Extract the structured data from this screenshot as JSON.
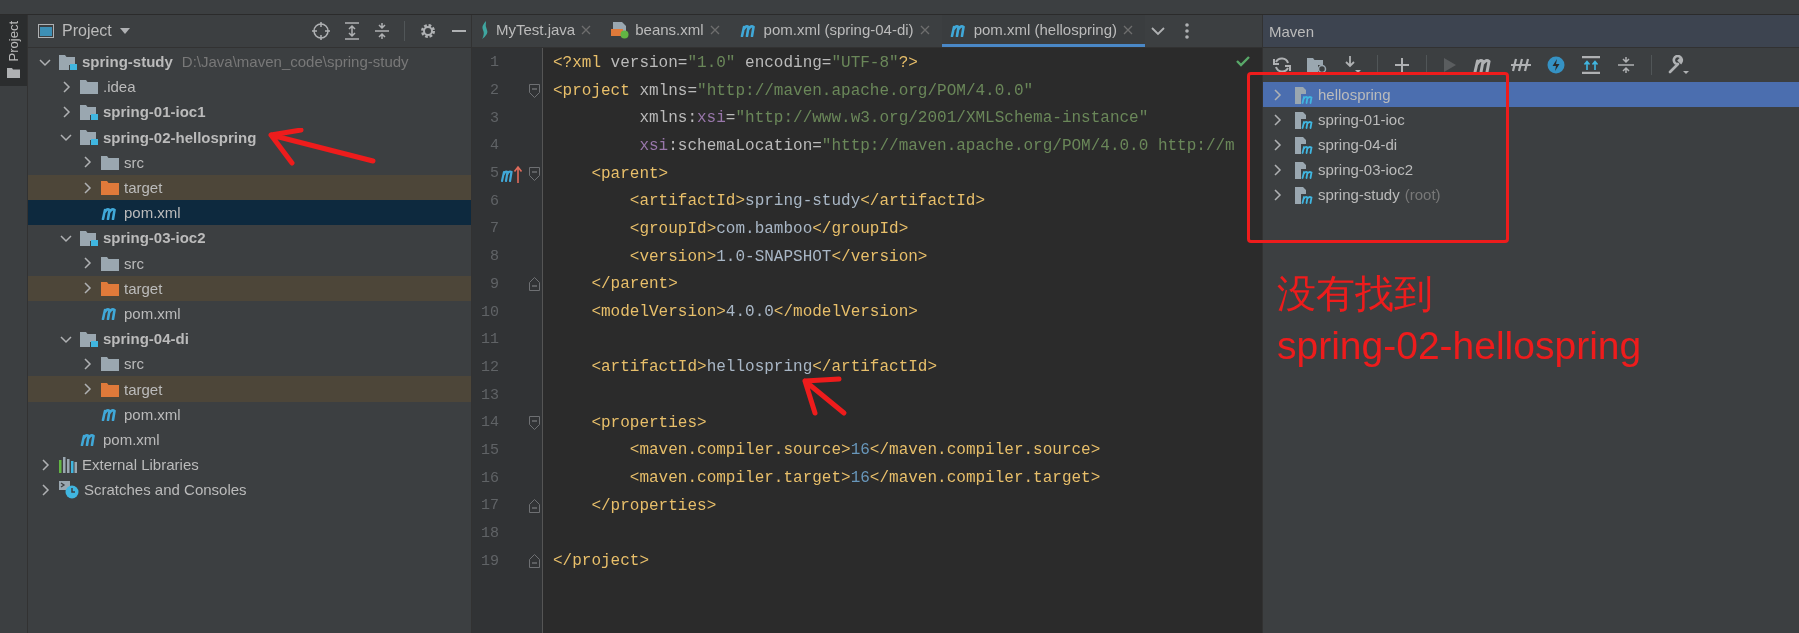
{
  "side_stripe": {
    "label": "Project"
  },
  "project": {
    "title": "Project",
    "tree": [
      {
        "name": "spring-study",
        "path": "D:\\Java\\maven_code\\spring-study",
        "kind": "module",
        "expanded": true,
        "selected": false,
        "children": [
          {
            "name": ".idea",
            "kind": "folder",
            "expanded": false,
            "selected": false
          },
          {
            "name": "spring-01-ioc1",
            "kind": "module",
            "expanded": false,
            "selected": false
          },
          {
            "name": "spring-02-hellospring",
            "kind": "module",
            "expanded": true,
            "selected": false,
            "children": [
              {
                "name": "src",
                "kind": "folder",
                "expanded": false,
                "selected": false
              },
              {
                "name": "target",
                "kind": "excluded",
                "expanded": false,
                "selected": false
              },
              {
                "name": "pom.xml",
                "kind": "maven",
                "selected": true
              }
            ]
          },
          {
            "name": "spring-03-ioc2",
            "kind": "module",
            "expanded": true,
            "selected": false,
            "children": [
              {
                "name": "src",
                "kind": "folder",
                "expanded": false,
                "selected": false
              },
              {
                "name": "target",
                "kind": "excluded",
                "expanded": false,
                "selected": false
              },
              {
                "name": "pom.xml",
                "kind": "maven",
                "selected": false
              }
            ]
          },
          {
            "name": "spring-04-di",
            "kind": "module",
            "expanded": true,
            "selected": false,
            "children": [
              {
                "name": "src",
                "kind": "folder",
                "expanded": false,
                "selected": false
              },
              {
                "name": "target",
                "kind": "excluded",
                "expanded": false,
                "selected": false
              },
              {
                "name": "pom.xml",
                "kind": "maven",
                "selected": false
              }
            ]
          },
          {
            "name": "pom.xml",
            "kind": "maven",
            "selected": false
          }
        ]
      },
      {
        "name": "External Libraries",
        "kind": "libraries",
        "expanded": false,
        "selected": false
      },
      {
        "name": "Scratches and Consoles",
        "kind": "scratches",
        "expanded": false,
        "selected": false
      }
    ]
  },
  "editor": {
    "tabs": [
      {
        "label": "MyTest.java",
        "kind": "java",
        "selected": false
      },
      {
        "label": "beans.xml",
        "kind": "beans",
        "selected": false
      },
      {
        "label": "pom.xml (spring-04-di)",
        "kind": "maven",
        "selected": false
      },
      {
        "label": "pom.xml (hellospring)",
        "kind": "maven",
        "selected": true
      }
    ],
    "lines": [
      {
        "number": "1",
        "kind": "plain",
        "tokens": [
          {
            "kind": "tag",
            "text": "<?xml "
          },
          {
            "kind": "attr",
            "text": "version="
          },
          {
            "kind": "str",
            "text": "\"1.0\""
          },
          {
            "kind": "attr",
            "text": " encoding="
          },
          {
            "kind": "str",
            "text": "\"UTF-8\""
          },
          {
            "kind": "tag",
            "text": "?>"
          }
        ]
      },
      {
        "number": "2",
        "kind": "opener",
        "tokens": [
          {
            "kind": "tag",
            "text": "<project "
          },
          {
            "kind": "attr",
            "text": "xmlns="
          },
          {
            "kind": "str",
            "text": "\"http://maven.apache.org/POM/4.0.0\""
          }
        ]
      },
      {
        "number": "3",
        "kind": "continued",
        "tokens": [
          {
            "kind": "attr",
            "text": "xmlns:"
          },
          {
            "kind": "ns",
            "text": "xsi"
          },
          {
            "kind": "attr",
            "text": "="
          },
          {
            "kind": "str",
            "text": "\"http://www.w3.org/2001/XMLSchema-instance\""
          }
        ]
      },
      {
        "number": "4",
        "kind": "continued",
        "tokens": [
          {
            "kind": "ns",
            "text": "xsi"
          },
          {
            "kind": "attr",
            "text": ":schemaLocation="
          },
          {
            "kind": "str",
            "text": "\"http://maven.apache.org/POM/4.0.0 http://m"
          }
        ]
      },
      {
        "number": "5",
        "kind": "parent",
        "tokens": [
          {
            "kind": "tag",
            "text": "    <parent>"
          }
        ]
      },
      {
        "number": "6",
        "kind": "plain",
        "tokens": [
          {
            "kind": "tag",
            "text": "        <artifactId>"
          },
          {
            "kind": "text",
            "text": "spring-study"
          },
          {
            "kind": "tag",
            "text": "</artifactId>"
          }
        ]
      },
      {
        "number": "7",
        "kind": "plain",
        "tokens": [
          {
            "kind": "tag",
            "text": "        <groupId>"
          },
          {
            "kind": "text",
            "text": "com.bamboo"
          },
          {
            "kind": "tag",
            "text": "</groupId>"
          }
        ]
      },
      {
        "number": "8",
        "kind": "plain",
        "tokens": [
          {
            "kind": "tag",
            "text": "        <version>"
          },
          {
            "kind": "text",
            "text": "1.0-SNAPSHOT"
          },
          {
            "kind": "tag",
            "text": "</version>"
          }
        ]
      },
      {
        "number": "9",
        "kind": "closer",
        "tokens": [
          {
            "kind": "tag",
            "text": "    </parent>"
          }
        ]
      },
      {
        "number": "10",
        "kind": "plain",
        "tokens": [
          {
            "kind": "tag",
            "text": "    <modelVersion>"
          },
          {
            "kind": "text",
            "text": "4.0.0"
          },
          {
            "kind": "tag",
            "text": "</modelVersion>"
          }
        ]
      },
      {
        "number": "11",
        "kind": "plain"
      },
      {
        "number": "12",
        "kind": "plain",
        "tokens": [
          {
            "kind": "tag",
            "text": "    <artifactId>"
          },
          {
            "kind": "text",
            "text": "hellospring"
          },
          {
            "kind": "tag",
            "text": "</artifactId>"
          }
        ]
      },
      {
        "number": "13",
        "kind": "plain"
      },
      {
        "number": "14",
        "kind": "opener",
        "tokens": [
          {
            "kind": "tag",
            "text": "    <properties>"
          }
        ]
      },
      {
        "number": "15",
        "kind": "plain",
        "tokens": [
          {
            "kind": "tag",
            "text": "        <maven.compiler.source>"
          },
          {
            "kind": "num",
            "text": "16"
          },
          {
            "kind": "tag",
            "text": "</maven.compiler.source>"
          }
        ]
      },
      {
        "number": "16",
        "kind": "plain",
        "tokens": [
          {
            "kind": "tag",
            "text": "        <maven.compiler.target>"
          },
          {
            "kind": "num",
            "text": "16"
          },
          {
            "kind": "tag",
            "text": "</maven.compiler.target>"
          }
        ]
      },
      {
        "number": "17",
        "kind": "closer",
        "tokens": [
          {
            "kind": "tag",
            "text": "    </properties>"
          }
        ]
      },
      {
        "number": "18",
        "kind": "plain"
      },
      {
        "number": "19",
        "kind": "closer",
        "tokens": [
          {
            "kind": "tag",
            "text": "</project>"
          }
        ]
      }
    ]
  },
  "maven": {
    "title": "Maven",
    "projects": [
      {
        "name": "hellospring",
        "selected": true,
        "expanded": false
      },
      {
        "name": "spring-01-ioc",
        "selected": false,
        "expanded": false
      },
      {
        "name": "spring-04-di",
        "selected": false,
        "expanded": false
      },
      {
        "name": "spring-03-ioc2",
        "selected": false,
        "expanded": false
      },
      {
        "name": "spring-study",
        "note": "(root)",
        "selected": false,
        "expanded": false
      }
    ]
  },
  "annotation": {
    "lines": [
      "没有找到",
      "spring-02-hellospring"
    ]
  }
}
